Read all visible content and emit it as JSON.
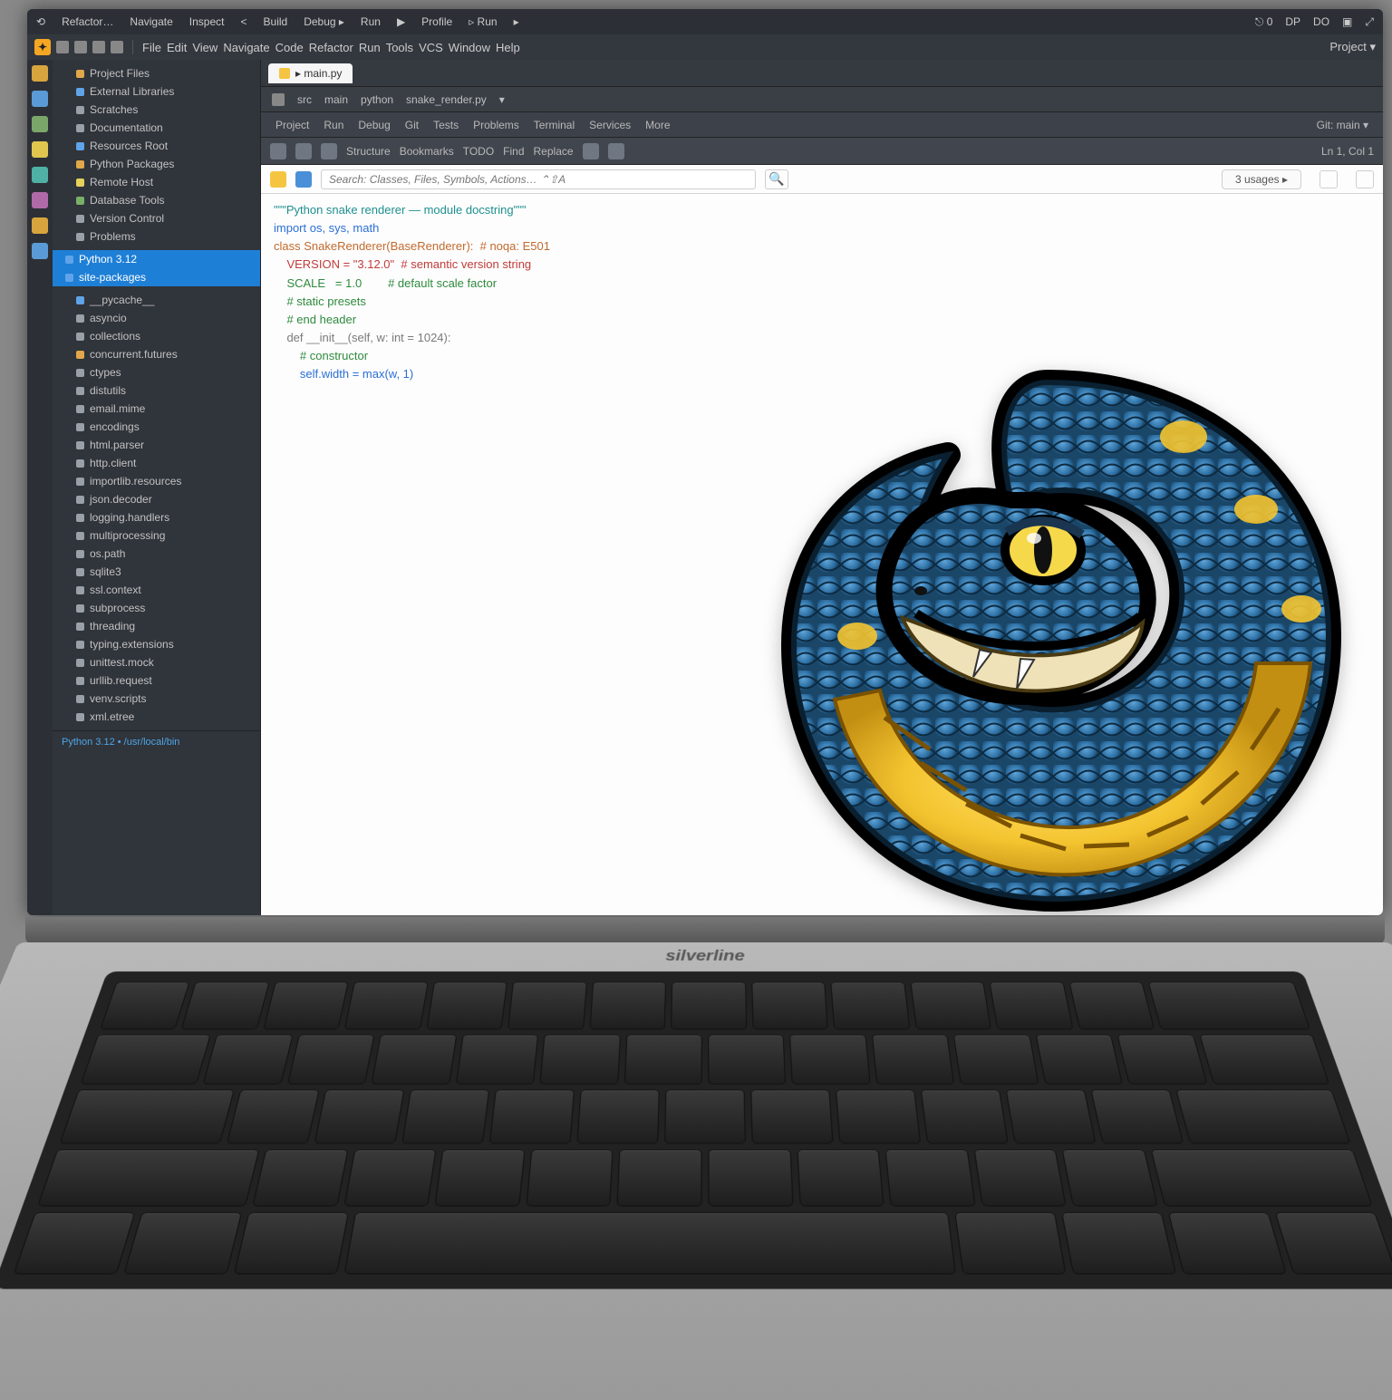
{
  "title": {
    "left": [
      "⟲",
      "Refactor…",
      "Navigate",
      "Inspect",
      "<",
      "Build",
      "Debug ▸",
      "Run",
      "▶",
      "Profile",
      "▹ Run",
      "▸"
    ],
    "right": [
      "⎋ 0",
      "DP",
      "DO",
      "▣",
      "⤢"
    ]
  },
  "menu": {
    "items": [
      "File",
      "Edit",
      "View",
      "Navigate",
      "Code",
      "Refactor",
      "Run",
      "Tools",
      "VCS",
      "Window",
      "Help"
    ],
    "rtext": "Project ▾"
  },
  "gutter": [
    "o",
    "b",
    "g",
    "y",
    "t",
    "p",
    "o",
    "b",
    "gr"
  ],
  "sidebar": {
    "top": [
      {
        "c": "o",
        "t": "Project Files"
      },
      {
        "c": "b",
        "t": "External Libraries"
      },
      {
        "c": "gr",
        "t": "Scratches"
      },
      {
        "c": "gr",
        "t": "Documentation"
      },
      {
        "c": "b",
        "t": "Resources Root"
      },
      {
        "c": "o",
        "t": "Python Packages"
      },
      {
        "c": "y",
        "t": "Remote Host"
      },
      {
        "c": "g",
        "t": "Database Tools"
      },
      {
        "c": "gr",
        "t": "Version Control"
      },
      {
        "c": "gr",
        "t": "Problems"
      }
    ],
    "sel1": "Python 3.12",
    "sel2": "site-packages",
    "mid": [
      {
        "c": "b",
        "t": "__pycache__"
      },
      {
        "c": "gr",
        "t": "asyncio"
      },
      {
        "c": "gr",
        "t": "collections"
      },
      {
        "c": "o",
        "t": "concurrent.futures"
      },
      {
        "c": "gr",
        "t": "ctypes"
      },
      {
        "c": "gr",
        "t": "distutils"
      },
      {
        "c": "gr",
        "t": "email.mime"
      },
      {
        "c": "gr",
        "t": "encodings"
      },
      {
        "c": "gr",
        "t": "html.parser"
      },
      {
        "c": "gr",
        "t": "http.client"
      },
      {
        "c": "gr",
        "t": "importlib.resources"
      },
      {
        "c": "gr",
        "t": "json.decoder"
      },
      {
        "c": "gr",
        "t": "logging.handlers"
      },
      {
        "c": "gr",
        "t": "multiprocessing"
      },
      {
        "c": "gr",
        "t": "os.path"
      },
      {
        "c": "gr",
        "t": "sqlite3"
      },
      {
        "c": "gr",
        "t": "ssl.context"
      },
      {
        "c": "gr",
        "t": "subprocess"
      },
      {
        "c": "gr",
        "t": "threading"
      },
      {
        "c": "gr",
        "t": "typing.extensions"
      },
      {
        "c": "gr",
        "t": "unittest.mock"
      },
      {
        "c": "gr",
        "t": "urllib.request"
      },
      {
        "c": "gr",
        "t": "venv.scripts"
      },
      {
        "c": "gr",
        "t": "xml.etree"
      }
    ],
    "foot": "Python 3.12 • /usr/local/bin"
  },
  "tabs": {
    "active": "▸ main.py",
    "others": []
  },
  "crumbs": [
    "src",
    "main",
    "python",
    "snake_render.py",
    "▾"
  ],
  "subbar": [
    "Project",
    "Run",
    "Debug",
    "Git",
    "Tests",
    "Problems",
    "Terminal",
    "Services",
    "More",
    "▾"
  ],
  "subbar_r": "Git: main ▾",
  "toolstrip": {
    "left": [
      "Structure",
      "Bookmarks",
      "TODO",
      "Find",
      "Replace"
    ],
    "right": "Ln 1, Col 1"
  },
  "addr": {
    "placeholder": "Search: Classes, Files, Symbols, Actions… ⌃⇧A",
    "pill": "3 usages ▸",
    "icons": 3
  },
  "code": [
    {
      "cls": "c-teal",
      "t": "\"\"\"Python snake renderer — module docstring\"\"\""
    },
    {
      "cls": "c-blue",
      "t": "import os, sys, math"
    },
    {
      "cls": "c-blk",
      "t": ""
    },
    {
      "cls": "c-ora",
      "t": "class SnakeRenderer(BaseRenderer):  # noqa: E501"
    },
    {
      "cls": "c-red",
      "t": "    VERSION = \"3.12.0\"  # semantic version string"
    },
    {
      "cls": "c-grn",
      "t": "    SCALE   = 1.0        # default scale factor"
    },
    {
      "cls": "c-grn",
      "t": "    # static presets"
    },
    {
      "cls": "c-grn",
      "t": "    # end header"
    },
    {
      "cls": "c-blk",
      "t": ""
    },
    {
      "cls": "c-gry",
      "t": "    def __init__(self, w: int = 1024):"
    },
    {
      "cls": "c-grn",
      "t": "        # constructor"
    },
    {
      "cls": "c-blue",
      "t": "        self.width = max(w, 1)"
    }
  ],
  "brand": "silverline"
}
